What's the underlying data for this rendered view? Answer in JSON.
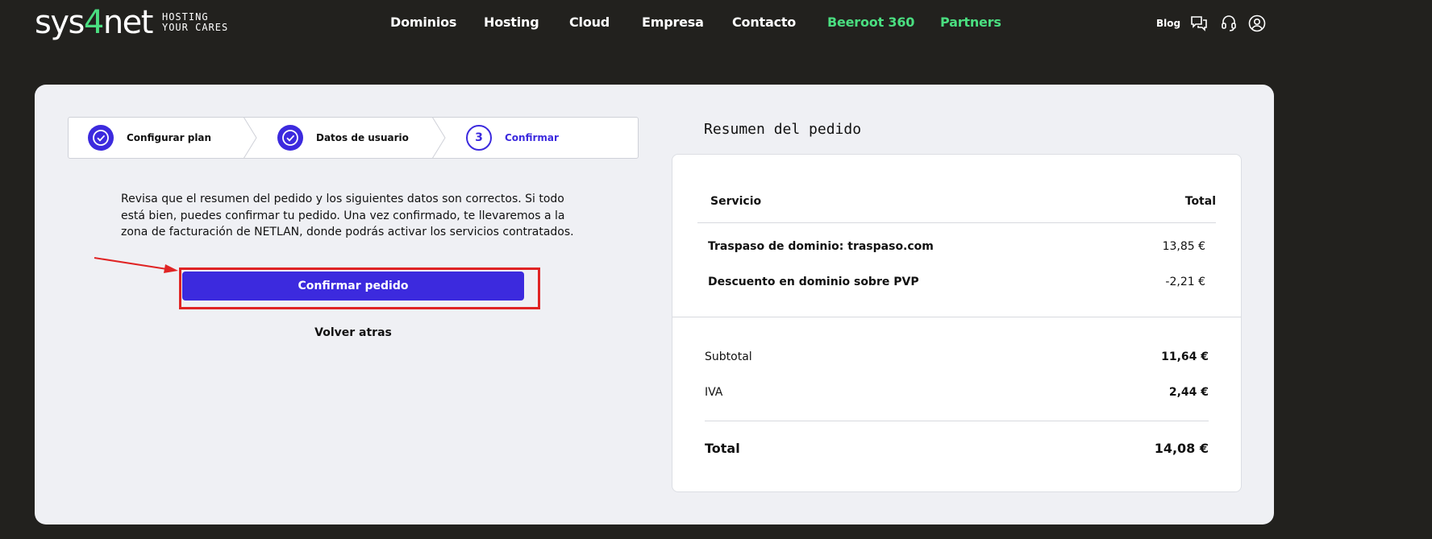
{
  "header": {
    "logo_prefix": "sys",
    "logo_accent": "4",
    "logo_suffix": "net",
    "tagline_line1": "HOSTING",
    "tagline_line2": "YOUR CARES",
    "nav": [
      "Dominios",
      "Hosting",
      "Cloud",
      "Empresa",
      "Contacto",
      "Beeroot 360",
      "Partners"
    ],
    "blog": "Blog",
    "icons": [
      "chat-icon",
      "headset-icon",
      "user-account-icon"
    ]
  },
  "stepper": {
    "steps": [
      {
        "label": "Configurar plan",
        "state": "done",
        "icon": "check-icon"
      },
      {
        "label": "Datos de usuario",
        "state": "done",
        "icon": "check-icon"
      },
      {
        "label": "Confirmar",
        "state": "active",
        "number": "3"
      }
    ]
  },
  "intro": "Revisa que el resumen del pedido y los siguientes datos son correctos. Si todo está bien, puedes confirmar tu pedido. Una vez confirmado, te llevaremos a la zona de facturación de NETLAN, donde podrás activar los servicios contratados.",
  "actions": {
    "confirm": "Confirmar pedido",
    "back": "Volver atras"
  },
  "summary": {
    "title": "Resumen del pedido",
    "col_service": "Servicio",
    "col_total": "Total",
    "items": [
      {
        "name": "Traspaso de dominio: traspaso.com",
        "price": "13,85 €"
      },
      {
        "name": "Descuento en dominio sobre PVP",
        "price": "-2,21 €"
      }
    ],
    "subtotal_label": "Subtotal",
    "subtotal_value": "11,64 €",
    "iva_label": "IVA",
    "iva_value": "2,44 €",
    "total_label": "Total",
    "total_value": "14,08 €"
  },
  "colors": {
    "accent": "#3c2ade",
    "green": "#4ade80",
    "background": "#22211e",
    "card": "#eff0f4",
    "highlight": "#e02424"
  }
}
